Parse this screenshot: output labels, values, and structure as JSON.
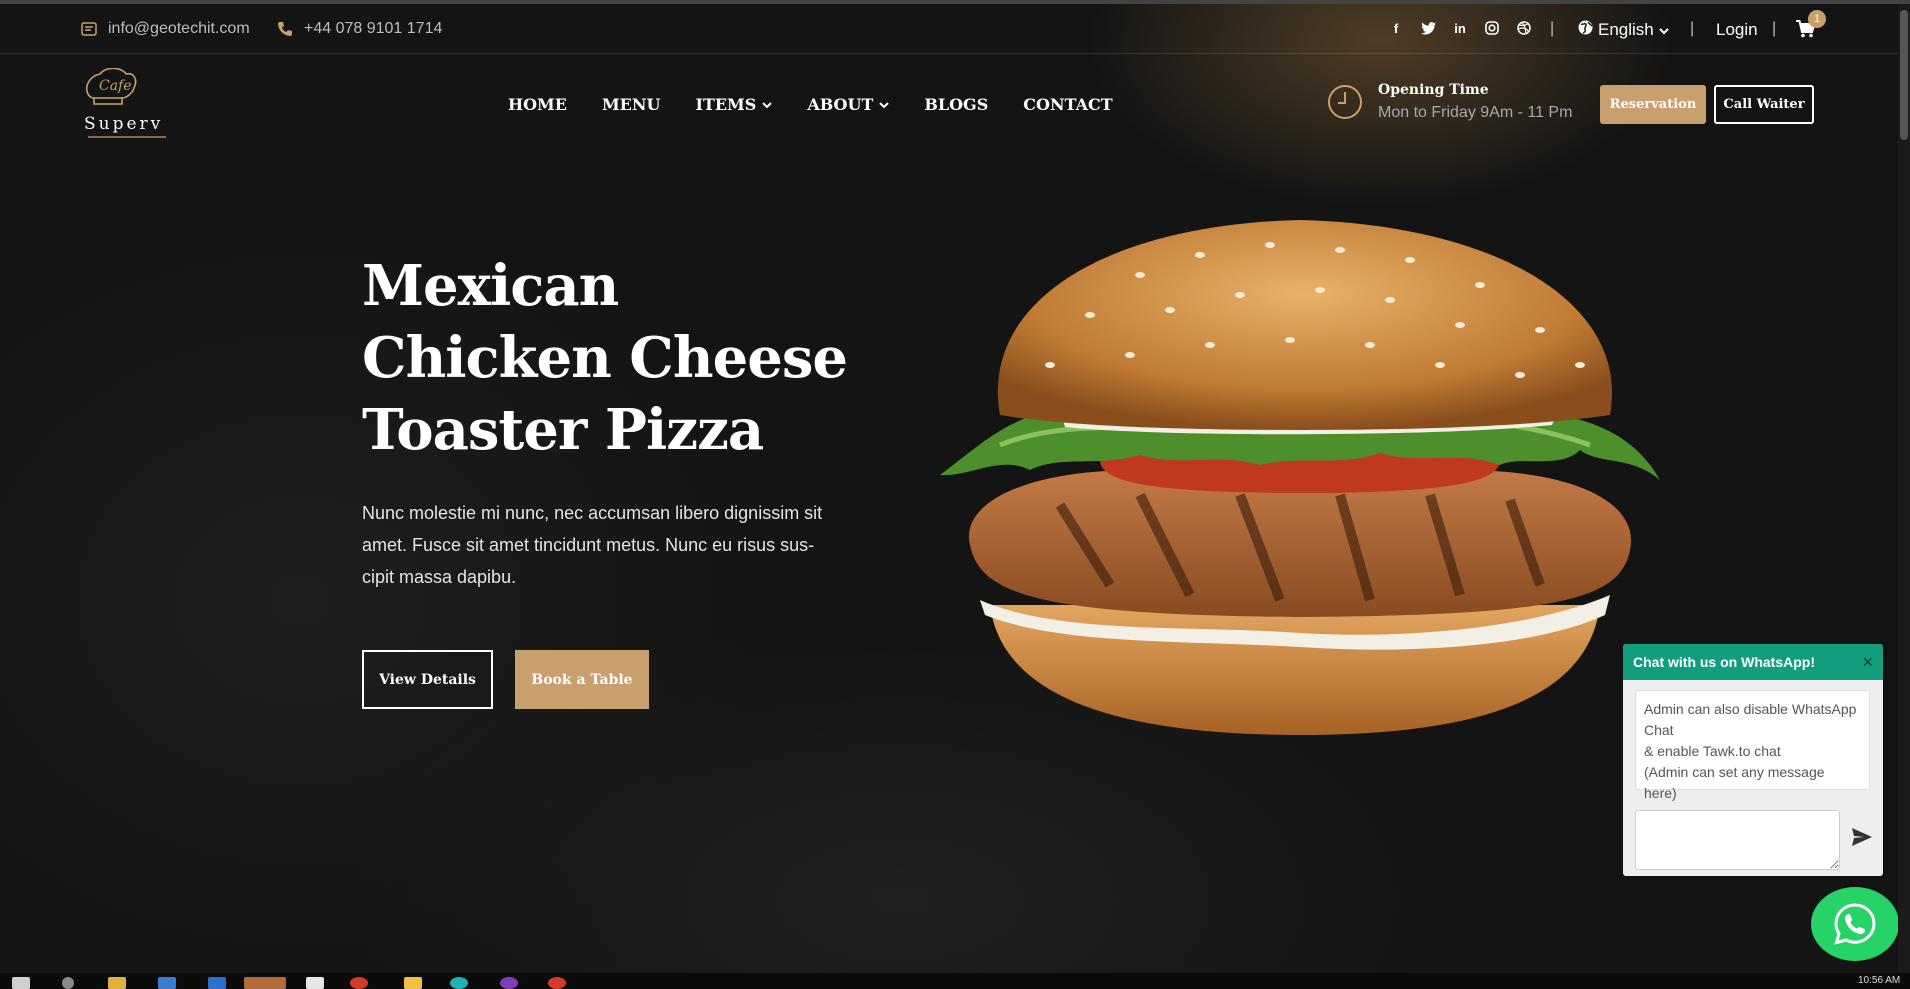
{
  "topbar": {
    "email": "info@geotechit.com",
    "phone": "+44 078 9101 1714",
    "social_icons": [
      "facebook-icon",
      "twitter-icon",
      "linkedin-icon",
      "instagram-icon",
      "dribbble-icon"
    ],
    "language": "English",
    "login": "Login",
    "cart_count": "1",
    "separator": "|"
  },
  "logo": {
    "script": "Cafe",
    "name": "Superv"
  },
  "nav": {
    "items": [
      {
        "label": "HOME",
        "dropdown": false
      },
      {
        "label": "MENU",
        "dropdown": false
      },
      {
        "label": "ITEMS",
        "dropdown": true
      },
      {
        "label": "ABOUT",
        "dropdown": true
      },
      {
        "label": "BLOGS",
        "dropdown": false
      },
      {
        "label": "CONTACT",
        "dropdown": false
      }
    ]
  },
  "opening": {
    "title": "Opening Time",
    "hours": "Mon to Friday 9Am - 11 Pm"
  },
  "header_buttons": {
    "reservation": "Reservation",
    "call_waiter": "Call Waiter"
  },
  "hero": {
    "title_lines": [
      "Mexican",
      "Chicken Cheese",
      "Toaster Pizza"
    ],
    "text_lines": [
      "Nunc molestie mi nunc, nec accumsan libero dignissim sit",
      "amet. Fusce sit amet tincidunt metus. Nunc eu risus sus-",
      "cipit massa dapibu."
    ],
    "view_details": "View Details",
    "book_table": "Book a Table"
  },
  "whatsapp": {
    "header": "Chat with us on WhatsApp!",
    "close": "×",
    "message_lines": [
      "Admin can also disable WhatsApp Chat",
      "& enable Tawk.to chat",
      "(Admin can set any message here)"
    ]
  },
  "taskbar": {
    "time": "10:56 AM"
  },
  "colors": {
    "accent": "#c9a06d",
    "whatsapp": "#119d7e",
    "whatsapp_button": "#25d366"
  }
}
